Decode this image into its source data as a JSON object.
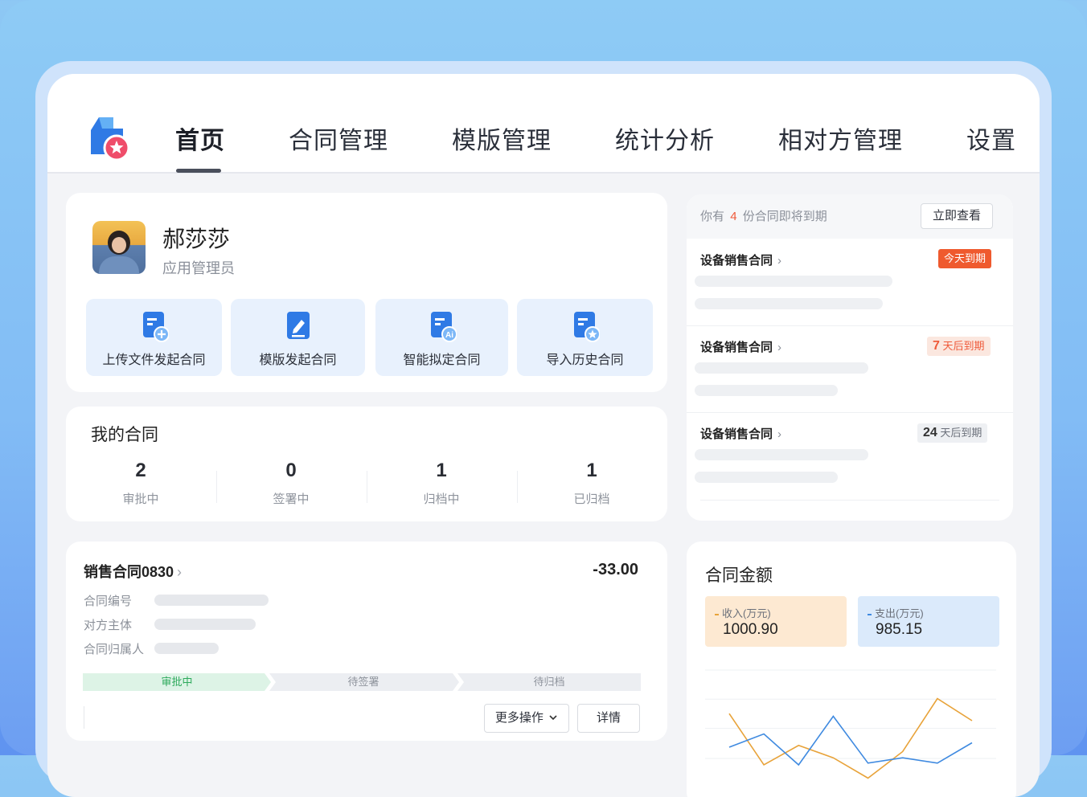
{
  "nav": {
    "tabs": [
      "首页",
      "合同管理",
      "模版管理",
      "统计分析",
      "相对方管理",
      "设置"
    ],
    "active_index": 0
  },
  "profile": {
    "name": "郝莎莎",
    "role": "应用管理员"
  },
  "quick_actions": [
    {
      "label": "上传文件发起合同",
      "icon": "upload-file-icon"
    },
    {
      "label": "模版发起合同",
      "icon": "template-edit-icon"
    },
    {
      "label": "智能拟定合同",
      "icon": "ai-draft-icon"
    },
    {
      "label": "导入历史合同",
      "icon": "import-history-icon"
    }
  ],
  "my_contracts": {
    "title": "我的合同",
    "stats": [
      {
        "value": "2",
        "label": "审批中"
      },
      {
        "value": "0",
        "label": "签署中"
      },
      {
        "value": "1",
        "label": "归档中"
      },
      {
        "value": "1",
        "label": "已归档"
      }
    ]
  },
  "contract_detail": {
    "title": "销售合同0830",
    "amount": "-33.00",
    "fields": [
      "合同编号",
      "对方主体",
      "合同归属人"
    ],
    "steps": [
      "审批中",
      "待签署",
      "待归档"
    ],
    "active_step": 0,
    "more_label": "更多操作",
    "detail_label": "详情"
  },
  "expiring": {
    "prefix": "你有",
    "count": "4",
    "suffix": "份合同即将到期",
    "view_label": "立即查看",
    "items": [
      {
        "title": "设备销售合同",
        "badge_num": "",
        "badge_text": "今天到期",
        "style": "today"
      },
      {
        "title": "设备销售合同",
        "badge_num": "7",
        "badge_text": "天后到期",
        "style": "soon"
      },
      {
        "title": "设备销售合同",
        "badge_num": "24",
        "badge_text": "天后到期",
        "style": "later"
      }
    ]
  },
  "amount_card": {
    "title": "合同金额",
    "income_label": "收入(万元)",
    "income_value": "1000.90",
    "expense_label": "支出(万元)",
    "expense_value": "985.15",
    "colors": {
      "income": "#e8a33a",
      "expense": "#3f8ae0"
    }
  },
  "chart_data": {
    "type": "line",
    "title": "",
    "xlabel": "",
    "ylabel": "",
    "series": [
      {
        "name": "收入(万元)",
        "values": [
          0.78,
          0.2,
          0.42,
          0.28,
          0.05,
          0.35,
          0.95,
          0.7
        ]
      },
      {
        "name": "支出(万元)",
        "values": [
          0.4,
          0.55,
          0.2,
          0.75,
          0.22,
          0.28,
          0.22,
          0.45
        ]
      }
    ],
    "grid": true
  }
}
